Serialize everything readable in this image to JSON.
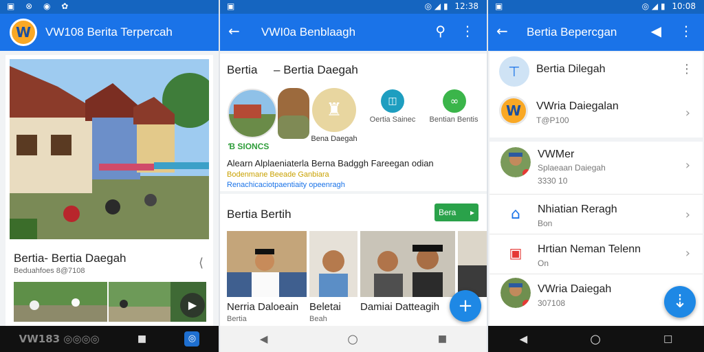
{
  "panel1": {
    "status": {
      "icons": "▣ ⊗ ◉ ✿"
    },
    "app_title": "VW108 Berita Terpercah",
    "logo_letter": "W",
    "article_title": "Bertia- Bertia Daegah",
    "article_meta": "Beduahfoes 8@7108",
    "nav_brand": "VW183 ◎◎◎◎",
    "colors": {
      "appbar": "#1a73e8",
      "statusbar": "#1565c0"
    }
  },
  "panel2": {
    "status_time": "12:38",
    "app_title": "VWI0a Benblaagh",
    "heading": "Bertia     – Bertia Daegah",
    "circle_labels": [
      "Bena Daegah",
      "Oertia Sainec",
      "Bentian Bentis"
    ],
    "stories_label": "Ɓ SIONCS",
    "description": "Alearn Alplaeniaterla Berna Badggh Fareegan odian",
    "green_line": "Bodenmane Beeade Ganbiara",
    "blue_line": "Renachicaciotpaentiaity opeenragh",
    "section_title": "Bertia Bertih",
    "section_button": "Bera",
    "grid": [
      {
        "name": "Nerria Daloeain",
        "sub": "Bertia"
      },
      {
        "name": "Beletai",
        "sub": "Beah"
      },
      {
        "name": "Damiai Datteagih",
        "sub": ""
      }
    ]
  },
  "panel3": {
    "status_time": "10:08",
    "app_title": "Bertia Bepercgan",
    "top_item": "Bertia Dilegah",
    "brand_item": {
      "title": "VWria Daiegalan",
      "sub": "T@P100"
    },
    "list": [
      {
        "title": "VWMer",
        "sub1": "Splaeaan Daiegah",
        "sub2": "3330 10"
      },
      {
        "title": "Nhiatian Reragh",
        "sub1": "Bon",
        "sub2": ""
      },
      {
        "title": "Hrtian Neman Telenn",
        "sub1": "On",
        "sub2": ""
      },
      {
        "title": "VWria Daiegah",
        "sub1": "307108",
        "sub2": ""
      }
    ]
  }
}
